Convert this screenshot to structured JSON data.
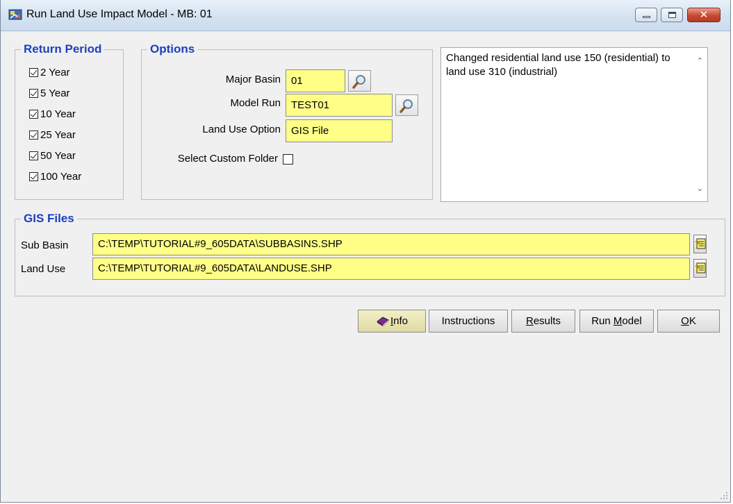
{
  "window": {
    "title": "Run Land Use Impact Model - MB: 01",
    "close_glyph": "✕"
  },
  "return_period": {
    "title": "Return Period",
    "items": [
      {
        "label": "2 Year",
        "checked": true
      },
      {
        "label": "5 Year",
        "checked": true
      },
      {
        "label": "10 Year",
        "checked": true
      },
      {
        "label": "25 Year",
        "checked": true
      },
      {
        "label": "50 Year",
        "checked": true
      },
      {
        "label": "100 Year",
        "checked": true
      }
    ]
  },
  "options": {
    "title": "Options",
    "major_basin_label": "Major Basin",
    "major_basin_value": "01",
    "model_run_label": "Model Run",
    "model_run_value": "TEST01",
    "land_use_option_label": "Land Use Option",
    "land_use_option_value": "GIS File",
    "select_custom_folder_label": "Select Custom Folder",
    "select_custom_folder_checked": false
  },
  "notes": {
    "text": "Changed residential land use 150 (residential) to land use 310 (industrial)"
  },
  "gis_files": {
    "title": "GIS Files",
    "sub_basin_label": "Sub Basin",
    "sub_basin_path": "C:\\TEMP\\TUTORIAL#9_605DATA\\SUBBASINS.SHP",
    "land_use_label": "Land Use",
    "land_use_path": "C:\\TEMP\\TUTORIAL#9_605DATA\\LANDUSE.SHP"
  },
  "buttons": {
    "info": {
      "pre": "",
      "key": "I",
      "post": "nfo"
    },
    "instructions": {
      "pre": "Instructions",
      "key": "",
      "post": ""
    },
    "results": {
      "pre": "",
      "key": "R",
      "post": "esults"
    },
    "run_model": {
      "pre": "Run ",
      "key": "M",
      "post": "odel"
    },
    "ok": {
      "pre": "",
      "key": "O",
      "post": "K"
    }
  },
  "colors": {
    "group_title": "#1d3fbf",
    "field_background": "#ffff88",
    "window_background": "#f0f0f0"
  },
  "icons": [
    "app-icon",
    "magnifier-icon",
    "file-browse-icon",
    "book-icon",
    "resize-grip-icon"
  ]
}
